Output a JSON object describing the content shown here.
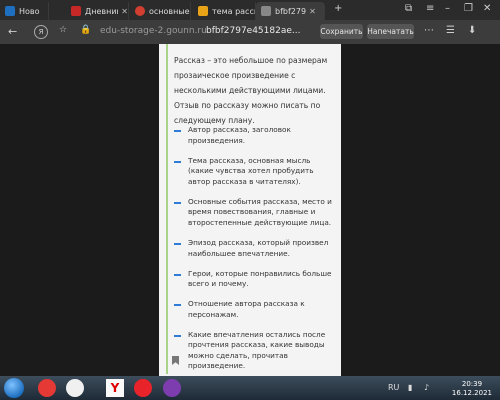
{
  "browser": {
    "tabs": [
      {
        "label": "Ново",
        "favicon_color": "#1e6fc0"
      },
      {
        "label": "Дневник",
        "favicon_color": "#c62828"
      },
      {
        "label": "основные",
        "favicon_color": "#d23f31"
      },
      {
        "label": "тема расск",
        "favicon_color": "#e8a317"
      },
      {
        "label": "bfbf279",
        "favicon_color": "#888888"
      }
    ],
    "domain": "edu-storage-2.gounn.ru",
    "page_title": "bfbf2797e45182ae...",
    "save_button": "Сохранить",
    "print_button": "Напечатать"
  },
  "document": {
    "intro": "Рассказ – это небольшое по размерам прозаическое произведение с несколькими действующими лицами. Отзыв по рассказу можно писать по следующему плану.",
    "items": [
      "Автор рассказа, заголовок произведения.",
      "Тема рассказа, основная мысль (какие чувства хотел пробудить автор рассказа в читателях).",
      "Основные события рассказа, место и время повествования, главные и второстепенные действующие лица.",
      "Эпизод рассказа, который произвел наибольшее впечатление.",
      "Герои, которые понравились больше всего и почему.",
      "Отношение автора рассказа к персонажам.",
      "Какие впечатления остались после прочтения рассказа, какие выводы можно сделать, прочитав произведение."
    ]
  },
  "taskbar": {
    "time": "20:39",
    "date": "16.12.2021",
    "tray_lang": "RU"
  }
}
